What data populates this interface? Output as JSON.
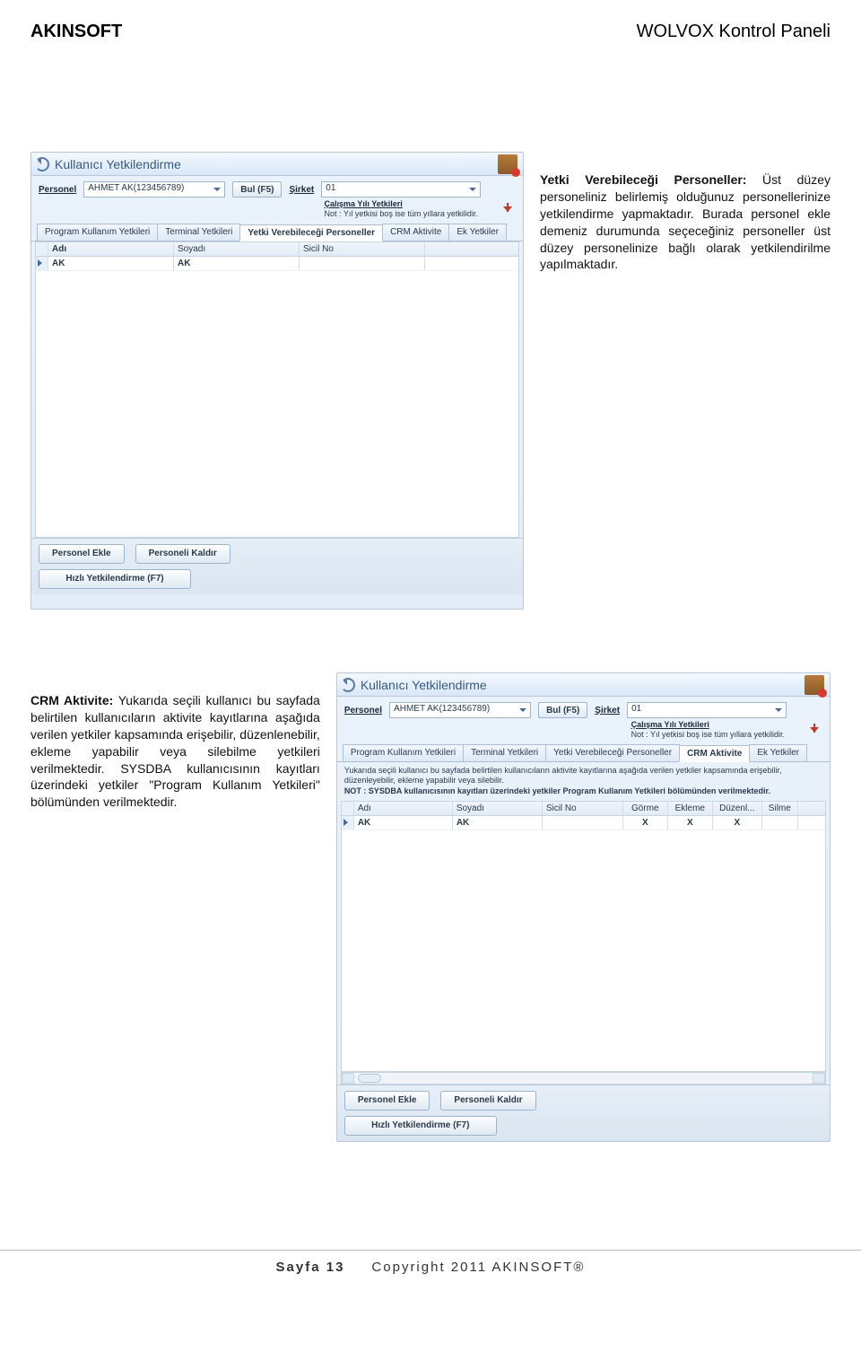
{
  "header": {
    "left": "AKINSOFT",
    "right": "WOLVOX Kontrol Paneli"
  },
  "panel1": {
    "title": "Kullanıcı Yetkilendirme",
    "personel_label": "Personel",
    "personel_value": "AHMET AK(123456789)",
    "bul_label": "Bul (F5)",
    "sirket_label": "Şirket",
    "sirket_value": "01",
    "calisma_label": "Çalışma Yılı Yetkileri",
    "not_label": "Not : Yıl yetkisi boş ise tüm yıllara yetkilidir.",
    "tabs": [
      "Program Kullanım Yetkileri",
      "Terminal Yetkileri",
      "Yetki Verebileceği Personeller",
      "CRM Aktivite",
      "Ek Yetkiler"
    ],
    "active_tab": 2,
    "grid_headers": [
      "Adı",
      "Soyadı",
      "Sicil No"
    ],
    "grid_row": [
      "AK",
      "AK",
      ""
    ],
    "btn_personel_ekle": "Personel Ekle",
    "btn_personel_kaldir": "Personeli Kaldır",
    "btn_hizli": "Hızlı Yetkilendirme (F7)"
  },
  "desc1_title": "Yetki Verebileceği Personeller:",
  "desc1_body": " Üst düzey personeliniz belirlemiş olduğunuz personellerinize yetkilendirme yapmaktadır. Burada personel ekle demeniz durumunda seçeceğiniz personeller üst düzey personelinize bağlı olarak yetkilendirilme yapılmaktadır.",
  "panel2": {
    "title": "Kullanıcı Yetkilendirme",
    "personel_label": "Personel",
    "personel_value": "AHMET AK(123456789)",
    "bul_label": "Bul (F5)",
    "sirket_label": "Şirket",
    "sirket_value": "01",
    "calisma_label": "Çalışma Yılı Yetkileri",
    "not_label": "Not : Yıl yetkisi boş ise tüm yıllara yetkilidir.",
    "tabs": [
      "Program Kullanım Yetkileri",
      "Terminal Yetkileri",
      "Yetki Verebileceği Personeller",
      "CRM Aktivite",
      "Ek Yetkiler"
    ],
    "active_tab": 3,
    "note1": "Yukarıda seçili kullanıcı bu sayfada belirtilen kullanıcıların aktivite kayıtlarına aşağıda verilen yetkiler kapsamında erişebilir, düzenleyebilir, ekleme yapabilir veya silebilir.",
    "note2": "NOT : SYSDBA kullanıcısının kayıtları üzerindeki yetkiler Program Kullanım Yetkileri bölümünden verilmektedir.",
    "grid_headers": [
      "Adı",
      "Soyadı",
      "Sicil No",
      "Görme",
      "Ekleme",
      "Düzenl...",
      "Silme"
    ],
    "grid_row": [
      "AK",
      "AK",
      "",
      "X",
      "X",
      "X",
      ""
    ],
    "btn_personel_ekle": "Personel Ekle",
    "btn_personel_kaldir": "Personeli Kaldır",
    "btn_hizli": "Hızlı Yetkilendirme (F7)"
  },
  "desc2_title": "CRM Aktivite:",
  "desc2_body": " Yukarıda seçili kullanıcı bu sayfada belirtilen kullanıcıların aktivite kayıtlarına aşağıda verilen yetkiler kapsamında erişebilir, düzenlenebilir, ekleme yapabilir veya silebilme yetkileri verilmektedir. SYSDBA  kullanıcısının kayıtları üzerindeki yetkiler \"Program Kullanım Yetkileri\" bölümünden verilmektedir.",
  "footer": {
    "page": "Sayfa 13",
    "copyright": "Copyright 2011 AKINSOFT®"
  }
}
